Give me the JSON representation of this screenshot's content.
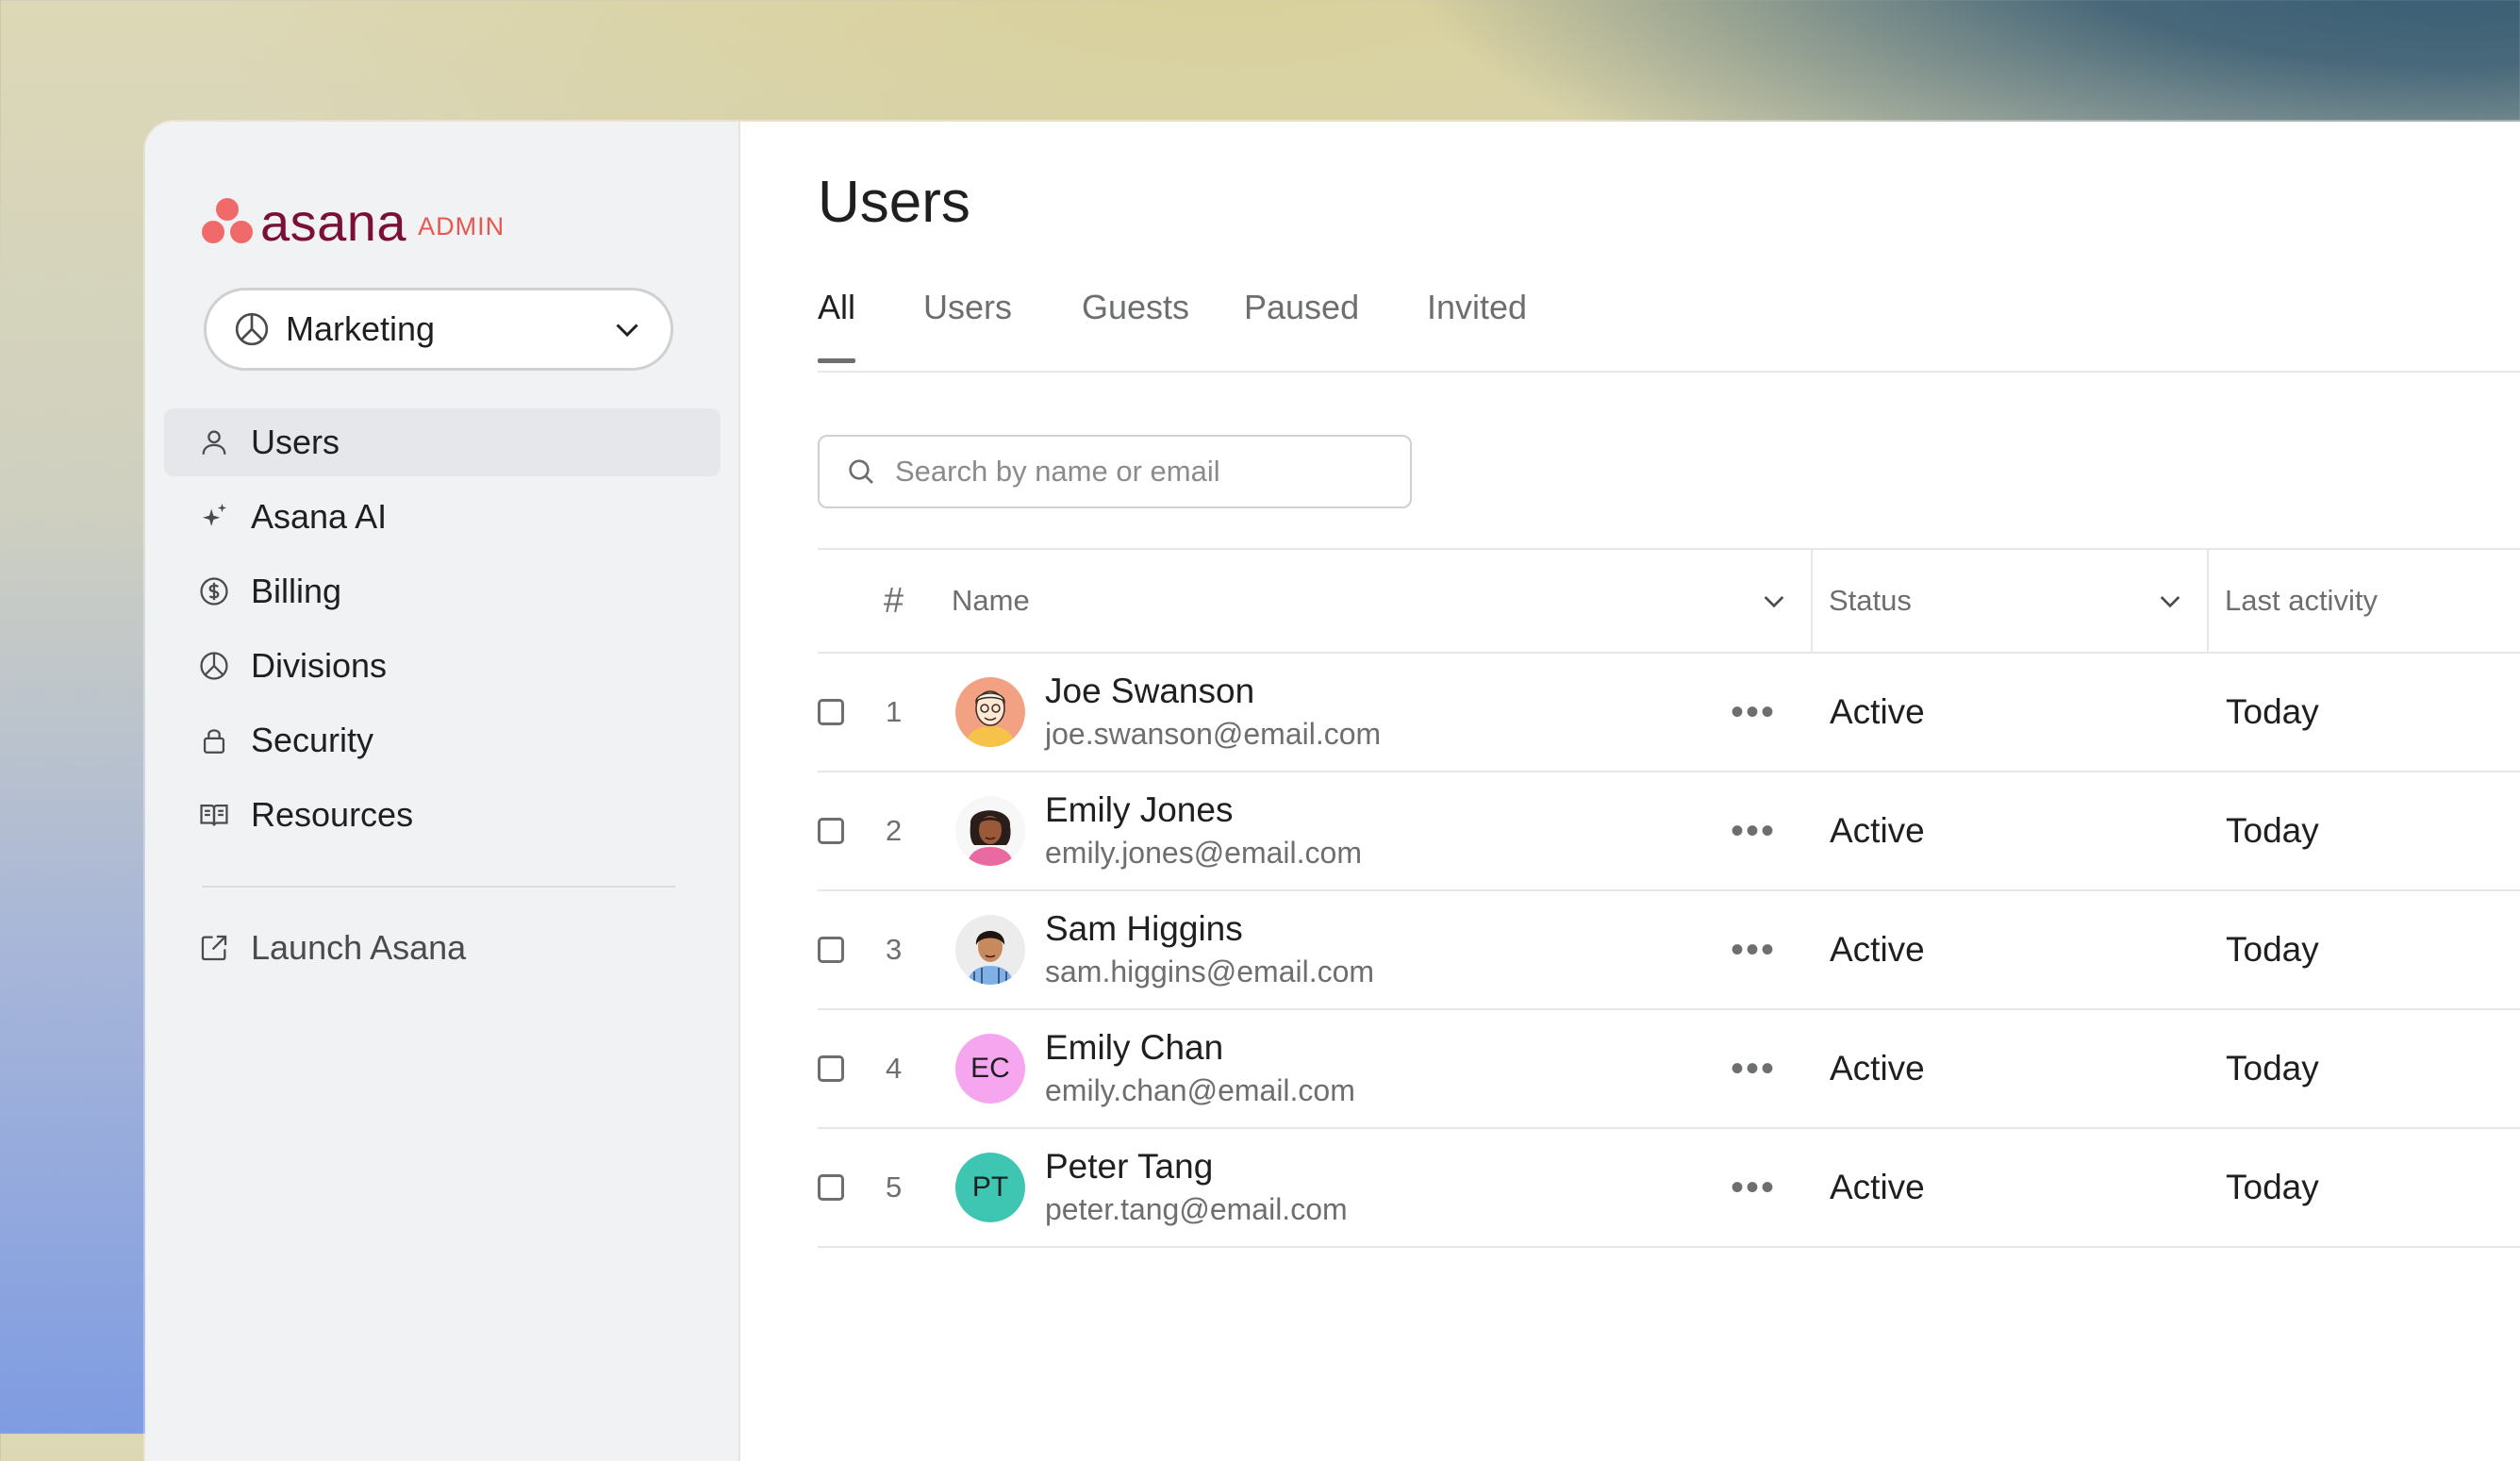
{
  "brand": {
    "wordmark": "asana",
    "badge": "ADMIN",
    "color_primary": "#f06a6a",
    "color_word": "#7a1037"
  },
  "workspace": {
    "label": "Marketing",
    "icon": "pie-chart-icon"
  },
  "sidebar": {
    "items": [
      {
        "label": "Users",
        "icon": "user-icon",
        "active": true
      },
      {
        "label": "Asana AI",
        "icon": "sparkle-icon"
      },
      {
        "label": "Billing",
        "icon": "dollar-icon"
      },
      {
        "label": "Divisions",
        "icon": "pie-chart-icon"
      },
      {
        "label": "Security",
        "icon": "lock-icon"
      },
      {
        "label": "Resources",
        "icon": "book-icon"
      }
    ],
    "launch": {
      "label": "Launch Asana",
      "icon": "external-link-icon"
    }
  },
  "page": {
    "title": "Users"
  },
  "tabs": [
    "All",
    "Users",
    "Guests",
    "Paused",
    "Invited"
  ],
  "search": {
    "placeholder": "Search by name or email"
  },
  "table": {
    "headers": {
      "number": "#",
      "name": "Name",
      "status": "Status",
      "last_activity": "Last activity"
    },
    "rows": [
      {
        "num": "1",
        "name": "Joe Swanson",
        "email": "joe.swanson@email.com",
        "status": "Active",
        "last": "Today",
        "avatar": "illustration",
        "avatar_color": "#f2a282"
      },
      {
        "num": "2",
        "name": "Emily Jones",
        "email": "emily.jones@email.com",
        "status": "Active",
        "last": "Today",
        "avatar": "illustration",
        "avatar_color": "#f7f7f7"
      },
      {
        "num": "3",
        "name": "Sam Higgins",
        "email": "sam.higgins@email.com",
        "status": "Active",
        "last": "Today",
        "avatar": "illustration",
        "avatar_color": "#ececec"
      },
      {
        "num": "4",
        "name": "Emily Chan",
        "email": "emily.chan@email.com",
        "status": "Active",
        "last": "Today",
        "avatar": "EC",
        "avatar_color": "#f6a6ee"
      },
      {
        "num": "5",
        "name": "Peter Tang",
        "email": "peter.tang@email.com",
        "status": "Active",
        "last": "Today",
        "avatar": "PT",
        "avatar_color": "#3fc6b3"
      }
    ],
    "more_label": "•••"
  }
}
